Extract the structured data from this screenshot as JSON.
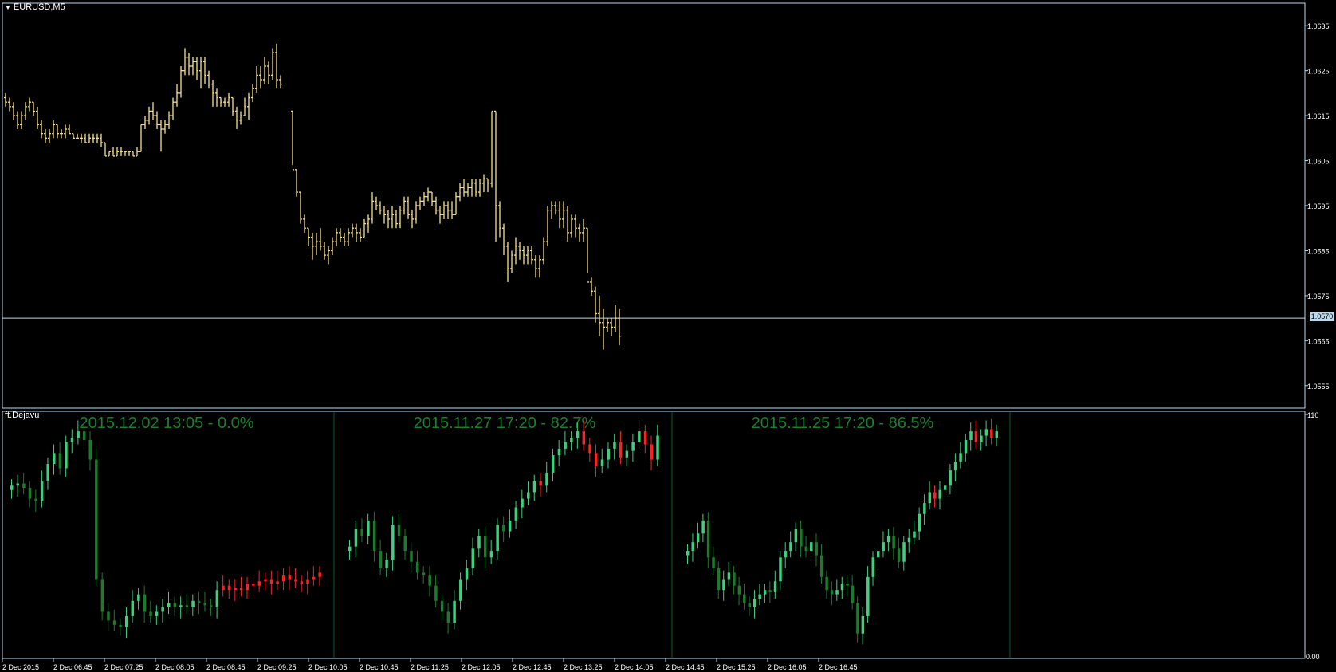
{
  "symbol": "EURUSD,M5",
  "indicator_name": "ft.Dejavu",
  "current_price": "1.0570",
  "colors": {
    "background": "#000000",
    "frame": "#bdd9ee",
    "ohlc_bars": "#f5e08c",
    "bull_candle": "#3fcf7f",
    "bull_candle_dark": "#1c7a2c",
    "bear_candle": "#ff2020",
    "match_text": "#1a7f2a",
    "separator": "#145a14"
  },
  "chart_data": [
    {
      "type": "ohlc",
      "symbol": "EURUSD",
      "timeframe": "M5",
      "y_ticks": [
        "1.0635",
        "1.0625",
        "1.0615",
        "1.0605",
        "1.0595",
        "1.0585",
        "1.0575",
        "1.0565",
        "1.0555"
      ],
      "ylim": [
        1.055,
        1.064
      ],
      "current_price_line": 1.057,
      "x_ticks": [
        "2 Dec 2015",
        "2 Dec 06:45",
        "2 Dec 07:25",
        "2 Dec 08:05",
        "2 Dec 08:45",
        "2 Dec 09:25",
        "2 Dec 10:05",
        "2 Dec 10:45",
        "2 Dec 11:25",
        "2 Dec 12:05",
        "2 Dec 12:45",
        "2 Dec 13:25",
        "2 Dec 14:05",
        "2 Dec 14:45",
        "2 Dec 15:25",
        "2 Dec 16:05",
        "2 Dec 16:45"
      ],
      "bars": [
        [
          1.0619,
          1.062,
          1.0617,
          1.0618
        ],
        [
          1.0618,
          1.0619,
          1.0616,
          1.0617
        ],
        [
          1.0617,
          1.0618,
          1.0614,
          1.0615
        ],
        [
          1.0615,
          1.0616,
          1.0612,
          1.0613
        ],
        [
          1.0613,
          1.0616,
          1.0612,
          1.0615
        ],
        [
          1.0615,
          1.0618,
          1.0614,
          1.0617
        ],
        [
          1.0617,
          1.0619,
          1.0616,
          1.0618
        ],
        [
          1.0618,
          1.0618,
          1.0615,
          1.0616
        ],
        [
          1.0616,
          1.0617,
          1.0612,
          1.0613
        ],
        [
          1.0613,
          1.0614,
          1.061,
          1.0611
        ],
        [
          1.0611,
          1.0612,
          1.0609,
          1.061
        ],
        [
          1.061,
          1.0612,
          1.0609,
          1.0611
        ],
        [
          1.0611,
          1.0614,
          1.061,
          1.0613
        ],
        [
          1.0613,
          1.0613,
          1.061,
          1.0611
        ],
        [
          1.0611,
          1.0612,
          1.061,
          1.0611
        ],
        [
          1.0611,
          1.0613,
          1.061,
          1.0612
        ],
        [
          1.0612,
          1.0613,
          1.0611,
          1.0611
        ],
        [
          1.0611,
          1.0611,
          1.061,
          1.061
        ],
        [
          1.061,
          1.0611,
          1.061,
          1.061
        ],
        [
          1.061,
          1.0611,
          1.0609,
          1.061
        ],
        [
          1.061,
          1.0611,
          1.0609,
          1.0609
        ],
        [
          1.0609,
          1.0611,
          1.0609,
          1.061
        ],
        [
          1.061,
          1.0611,
          1.0609,
          1.061
        ],
        [
          1.061,
          1.0611,
          1.0609,
          1.061
        ],
        [
          1.061,
          1.0611,
          1.0608,
          1.0609
        ],
        [
          1.0609,
          1.0609,
          1.0606,
          1.0606
        ],
        [
          1.0606,
          1.0607,
          1.0606,
          1.0607
        ],
        [
          1.0607,
          1.0608,
          1.0606,
          1.0606
        ],
        [
          1.0606,
          1.0608,
          1.0606,
          1.0607
        ],
        [
          1.0607,
          1.0608,
          1.0606,
          1.0607
        ],
        [
          1.0607,
          1.0607,
          1.0606,
          1.0607
        ],
        [
          1.0607,
          1.0607,
          1.0606,
          1.0607
        ],
        [
          1.0607,
          1.0607,
          1.0606,
          1.0606
        ],
        [
          1.0606,
          1.0608,
          1.0606,
          1.0607
        ],
        [
          1.0607,
          1.0613,
          1.0607,
          1.0613
        ],
        [
          1.0613,
          1.0615,
          1.0612,
          1.0614
        ],
        [
          1.0614,
          1.0617,
          1.0613,
          1.0616
        ],
        [
          1.0616,
          1.0618,
          1.0614,
          1.0615
        ],
        [
          1.0615,
          1.0616,
          1.0612,
          1.0613
        ],
        [
          1.0613,
          1.0614,
          1.0607,
          1.0612
        ],
        [
          1.0612,
          1.0614,
          1.0611,
          1.0613
        ],
        [
          1.0613,
          1.0616,
          1.0612,
          1.0615
        ],
        [
          1.0615,
          1.0619,
          1.0614,
          1.0618
        ],
        [
          1.0618,
          1.0622,
          1.0617,
          1.062
        ],
        [
          1.062,
          1.0626,
          1.0619,
          1.0625
        ],
        [
          1.0625,
          1.063,
          1.0624,
          1.0628
        ],
        [
          1.0628,
          1.0629,
          1.0624,
          1.0626
        ],
        [
          1.0626,
          1.0628,
          1.0624,
          1.0627
        ],
        [
          1.0627,
          1.0628,
          1.0623,
          1.0625
        ],
        [
          1.0625,
          1.0628,
          1.0621,
          1.0627
        ],
        [
          1.0627,
          1.0628,
          1.0622,
          1.0624
        ],
        [
          1.0624,
          1.0625,
          1.0621,
          1.0622
        ],
        [
          1.0622,
          1.0623,
          1.0617,
          1.062
        ],
        [
          1.062,
          1.0621,
          1.0617,
          1.0619
        ],
        [
          1.0619,
          1.0619,
          1.0617,
          1.0618
        ],
        [
          1.0618,
          1.0619,
          1.0617,
          1.0618
        ],
        [
          1.0618,
          1.062,
          1.0617,
          1.0619
        ],
        [
          1.0619,
          1.0619,
          1.0615,
          1.0616
        ],
        [
          1.0616,
          1.0617,
          1.0612,
          1.0614
        ],
        [
          1.0614,
          1.0616,
          1.0613,
          1.0615
        ],
        [
          1.0615,
          1.0619,
          1.0615,
          1.0617
        ],
        [
          1.0617,
          1.062,
          1.0614,
          1.0619
        ],
        [
          1.0619,
          1.0622,
          1.0618,
          1.0621
        ],
        [
          1.0621,
          1.0626,
          1.062,
          1.0624
        ],
        [
          1.0624,
          1.0626,
          1.0621,
          1.0623
        ],
        [
          1.0623,
          1.0628,
          1.0622,
          1.0626
        ],
        [
          1.0626,
          1.0627,
          1.0622,
          1.0624
        ],
        [
          1.0624,
          1.063,
          1.0623,
          1.0629
        ],
        [
          1.0629,
          1.0631,
          1.0621,
          1.0623
        ],
        [
          1.0623,
          1.0624,
          1.0621,
          1.0622
        ],
        [
          1.0616,
          1.0616,
          1.0604,
          1.0603
        ],
        [
          1.0603,
          1.0603,
          1.0597,
          1.0598
        ],
        [
          1.0598,
          1.0598,
          1.0591,
          1.0592
        ],
        [
          1.0592,
          1.0593,
          1.0589,
          1.059
        ],
        [
          1.059,
          1.059,
          1.0586,
          1.0588
        ],
        [
          1.0588,
          1.0589,
          1.0583,
          1.0586
        ],
        [
          1.0586,
          1.0589,
          1.0584,
          1.0587
        ],
        [
          1.0587,
          1.059,
          1.0585,
          1.0586
        ],
        [
          1.0586,
          1.0587,
          1.0583,
          1.0584
        ],
        [
          1.0584,
          1.0586,
          1.0582,
          1.0585
        ],
        [
          1.0585,
          1.0588,
          1.0584,
          1.0587
        ],
        [
          1.0587,
          1.059,
          1.0586,
          1.0589
        ],
        [
          1.0589,
          1.059,
          1.0587,
          1.0588
        ],
        [
          1.0588,
          1.0589,
          1.0586,
          1.0587
        ],
        [
          1.0587,
          1.059,
          1.0586,
          1.0589
        ],
        [
          1.0589,
          1.0591,
          1.0588,
          1.059
        ],
        [
          1.059,
          1.0591,
          1.0587,
          1.0589
        ],
        [
          1.0589,
          1.059,
          1.0587,
          1.0588
        ],
        [
          1.0588,
          1.0592,
          1.0588,
          1.0591
        ],
        [
          1.0591,
          1.0593,
          1.0589,
          1.0592
        ],
        [
          1.0592,
          1.0598,
          1.0591,
          1.0596
        ],
        [
          1.0596,
          1.0597,
          1.0594,
          1.0595
        ],
        [
          1.0595,
          1.0596,
          1.0593,
          1.0594
        ],
        [
          1.0594,
          1.0595,
          1.0591,
          1.0593
        ],
        [
          1.0593,
          1.0594,
          1.059,
          1.0592
        ],
        [
          1.0592,
          1.0595,
          1.059,
          1.0593
        ],
        [
          1.0593,
          1.0594,
          1.059,
          1.0591
        ],
        [
          1.0591,
          1.0595,
          1.059,
          1.0594
        ],
        [
          1.0594,
          1.0597,
          1.0593,
          1.0596
        ],
        [
          1.0596,
          1.0597,
          1.0592,
          1.0593
        ],
        [
          1.0593,
          1.0594,
          1.059,
          1.0592
        ],
        [
          1.0592,
          1.0596,
          1.0591,
          1.0595
        ],
        [
          1.0595,
          1.0597,
          1.0594,
          1.0596
        ],
        [
          1.0596,
          1.0598,
          1.0595,
          1.0597
        ],
        [
          1.0597,
          1.0599,
          1.0596,
          1.0598
        ],
        [
          1.0598,
          1.0598,
          1.0595,
          1.0596
        ],
        [
          1.0596,
          1.0597,
          1.0593,
          1.0594
        ],
        [
          1.0594,
          1.0595,
          1.0591,
          1.0593
        ],
        [
          1.0593,
          1.0596,
          1.0592,
          1.0595
        ],
        [
          1.0595,
          1.0596,
          1.0592,
          1.0594
        ],
        [
          1.0594,
          1.0596,
          1.0592,
          1.0593
        ],
        [
          1.0593,
          1.0598,
          1.0593,
          1.0597
        ],
        [
          1.0597,
          1.06,
          1.0596,
          1.0599
        ],
        [
          1.0599,
          1.0601,
          1.0597,
          1.0598
        ],
        [
          1.0598,
          1.06,
          1.0597,
          1.0599
        ],
        [
          1.0599,
          1.0601,
          1.0597,
          1.06
        ],
        [
          1.06,
          1.0601,
          1.0597,
          1.0598
        ],
        [
          1.0598,
          1.0601,
          1.0597,
          1.06
        ],
        [
          1.06,
          1.0602,
          1.0598,
          1.0601
        ],
        [
          1.0601,
          1.0601,
          1.0598,
          1.06
        ],
        [
          1.06,
          1.0616,
          1.0599,
          1.0616
        ],
        [
          1.0616,
          1.0616,
          1.0587,
          1.0595
        ],
        [
          1.0595,
          1.0596,
          1.0588,
          1.059
        ],
        [
          1.059,
          1.0591,
          1.0584,
          1.0586
        ],
        [
          1.0586,
          1.0587,
          1.0578,
          1.0581
        ],
        [
          1.0581,
          1.0585,
          1.058,
          1.0584
        ],
        [
          1.0584,
          1.0588,
          1.0582,
          1.0586
        ],
        [
          1.0586,
          1.0587,
          1.0583,
          1.0585
        ],
        [
          1.0585,
          1.0586,
          1.0582,
          1.0584
        ],
        [
          1.0584,
          1.0586,
          1.0582,
          1.0585
        ],
        [
          1.0585,
          1.0586,
          1.0582,
          1.0583
        ],
        [
          1.0583,
          1.0584,
          1.0579,
          1.0581
        ],
        [
          1.0581,
          1.0584,
          1.0579,
          1.0583
        ],
        [
          1.0583,
          1.0588,
          1.0582,
          1.0587
        ],
        [
          1.0587,
          1.0595,
          1.0586,
          1.0594
        ],
        [
          1.0594,
          1.0596,
          1.0592,
          1.0595
        ],
        [
          1.0595,
          1.0596,
          1.0593,
          1.0594
        ],
        [
          1.0594,
          1.0596,
          1.059,
          1.0592
        ],
        [
          1.0592,
          1.0596,
          1.059,
          1.0594
        ],
        [
          1.0594,
          1.0595,
          1.0587,
          1.0589
        ],
        [
          1.0589,
          1.0593,
          1.0588,
          1.0592
        ],
        [
          1.0592,
          1.0593,
          1.0588,
          1.059
        ],
        [
          1.059,
          1.0591,
          1.0587,
          1.0589
        ],
        [
          1.0589,
          1.0592,
          1.0587,
          1.059
        ],
        [
          1.059,
          1.059,
          1.058,
          1.0578
        ],
        [
          1.0578,
          1.0579,
          1.0575,
          1.0576
        ],
        [
          1.0576,
          1.0577,
          1.0569,
          1.0571
        ],
        [
          1.0571,
          1.0575,
          1.0566,
          1.0569
        ],
        [
          1.0569,
          1.0572,
          1.0563,
          1.0568
        ],
        [
          1.0568,
          1.057,
          1.0567,
          1.0569
        ],
        [
          1.0569,
          1.057,
          1.0566,
          1.0568
        ],
        [
          1.0568,
          1.0573,
          1.0567,
          1.057
        ],
        [
          1.057,
          1.0572,
          1.0564,
          1.0566
        ]
      ]
    },
    {
      "type": "candlestick",
      "indicator": "ft.Dejavu",
      "y_ticks": [
        "110",
        "0.00"
      ],
      "panels": [
        {
          "label": "2015.12.02 13:05 - 0.0%",
          "closes": [
            78,
            79,
            77,
            72,
            71,
            80,
            88,
            93,
            86,
            98,
            100,
            103,
            99,
            90,
            35,
            20,
            16,
            14,
            13,
            18,
            25,
            28,
            20,
            18,
            20,
            22,
            24,
            22,
            23,
            22,
            25,
            24,
            23,
            22,
            30,
            32,
            30,
            31,
            30,
            33,
            32,
            34,
            35,
            33,
            34,
            37,
            35,
            34,
            33,
            35,
            36,
            38
          ]
        },
        {
          "label": "2015.11.27 17:20 - 82.7%",
          "closes": [
            50,
            58,
            55,
            62,
            48,
            40,
            44,
            60,
            55,
            48,
            43,
            38,
            37,
            32,
            25,
            20,
            15,
            25,
            35,
            40,
            49,
            55,
            45,
            48,
            60,
            57,
            62,
            68,
            72,
            75,
            80,
            78,
            84,
            92,
            95,
            98,
            100,
            103,
            97,
            93,
            87,
            90,
            95,
            98,
            91,
            94,
            98,
            103,
            97,
            90,
            101
          ]
        },
        {
          "label": "2015.11.25 17:20 - 86.5%",
          "closes": [
            48,
            52,
            56,
            62,
            45,
            40,
            30,
            35,
            38,
            32,
            28,
            24,
            22,
            26,
            28,
            30,
            29,
            34,
            45,
            48,
            52,
            58,
            50,
            48,
            52,
            46,
            36,
            30,
            28,
            30,
            33,
            32,
            24,
            10,
            18,
            36,
            45,
            48,
            52,
            55,
            49,
            43,
            52,
            54,
            57,
            65,
            70,
            75,
            72,
            76,
            78,
            85,
            89,
            93,
            99,
            103,
            98,
            101,
            104,
            100,
            103
          ]
        }
      ]
    }
  ]
}
